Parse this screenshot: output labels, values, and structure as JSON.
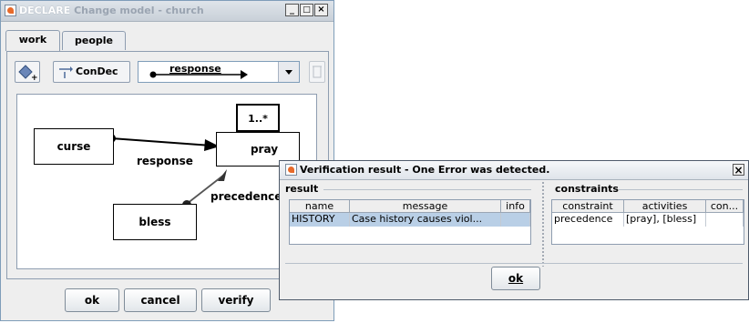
{
  "main_window": {
    "title_prefix": "DECLARE",
    "title_rest": " Change model - church",
    "controls": {
      "minimize": "_",
      "maximize": "□",
      "close": "×"
    }
  },
  "tabs": [
    {
      "label": "work",
      "active": true
    },
    {
      "label": "people",
      "active": false
    }
  ],
  "toolbar": {
    "add_icon": "diamond-plus-icon",
    "condec_label": "ConDec",
    "constraint_combo_value": "response",
    "delete_icon": "trash-icon"
  },
  "model": {
    "activities": [
      "curse",
      "pray",
      "bless"
    ],
    "cardinality": "1..*",
    "edges": [
      {
        "label": "response",
        "from": "curse",
        "to": "pray"
      },
      {
        "label": "precedence",
        "from": "pray",
        "to": "bless"
      }
    ]
  },
  "buttons": {
    "ok": "ok",
    "cancel": "cancel",
    "verify": "verify"
  },
  "dialog": {
    "title": "Verification result - One Error was detected.",
    "close": "×",
    "result": {
      "group_title": "result",
      "columns": [
        "name",
        "message",
        "info"
      ],
      "rows": [
        [
          "HISTORY",
          "Case history causes viol...",
          ""
        ]
      ]
    },
    "constraints": {
      "group_title": "constraints",
      "columns": [
        "constraint",
        "activities",
        "con..."
      ],
      "rows": [
        [
          "precedence",
          "[pray], [bless]",
          ""
        ]
      ]
    },
    "ok_label": "ok"
  },
  "colors": {
    "selection": "#b9cfe6",
    "border": "#8e9db0",
    "accent_icon": "#e76a2a"
  }
}
